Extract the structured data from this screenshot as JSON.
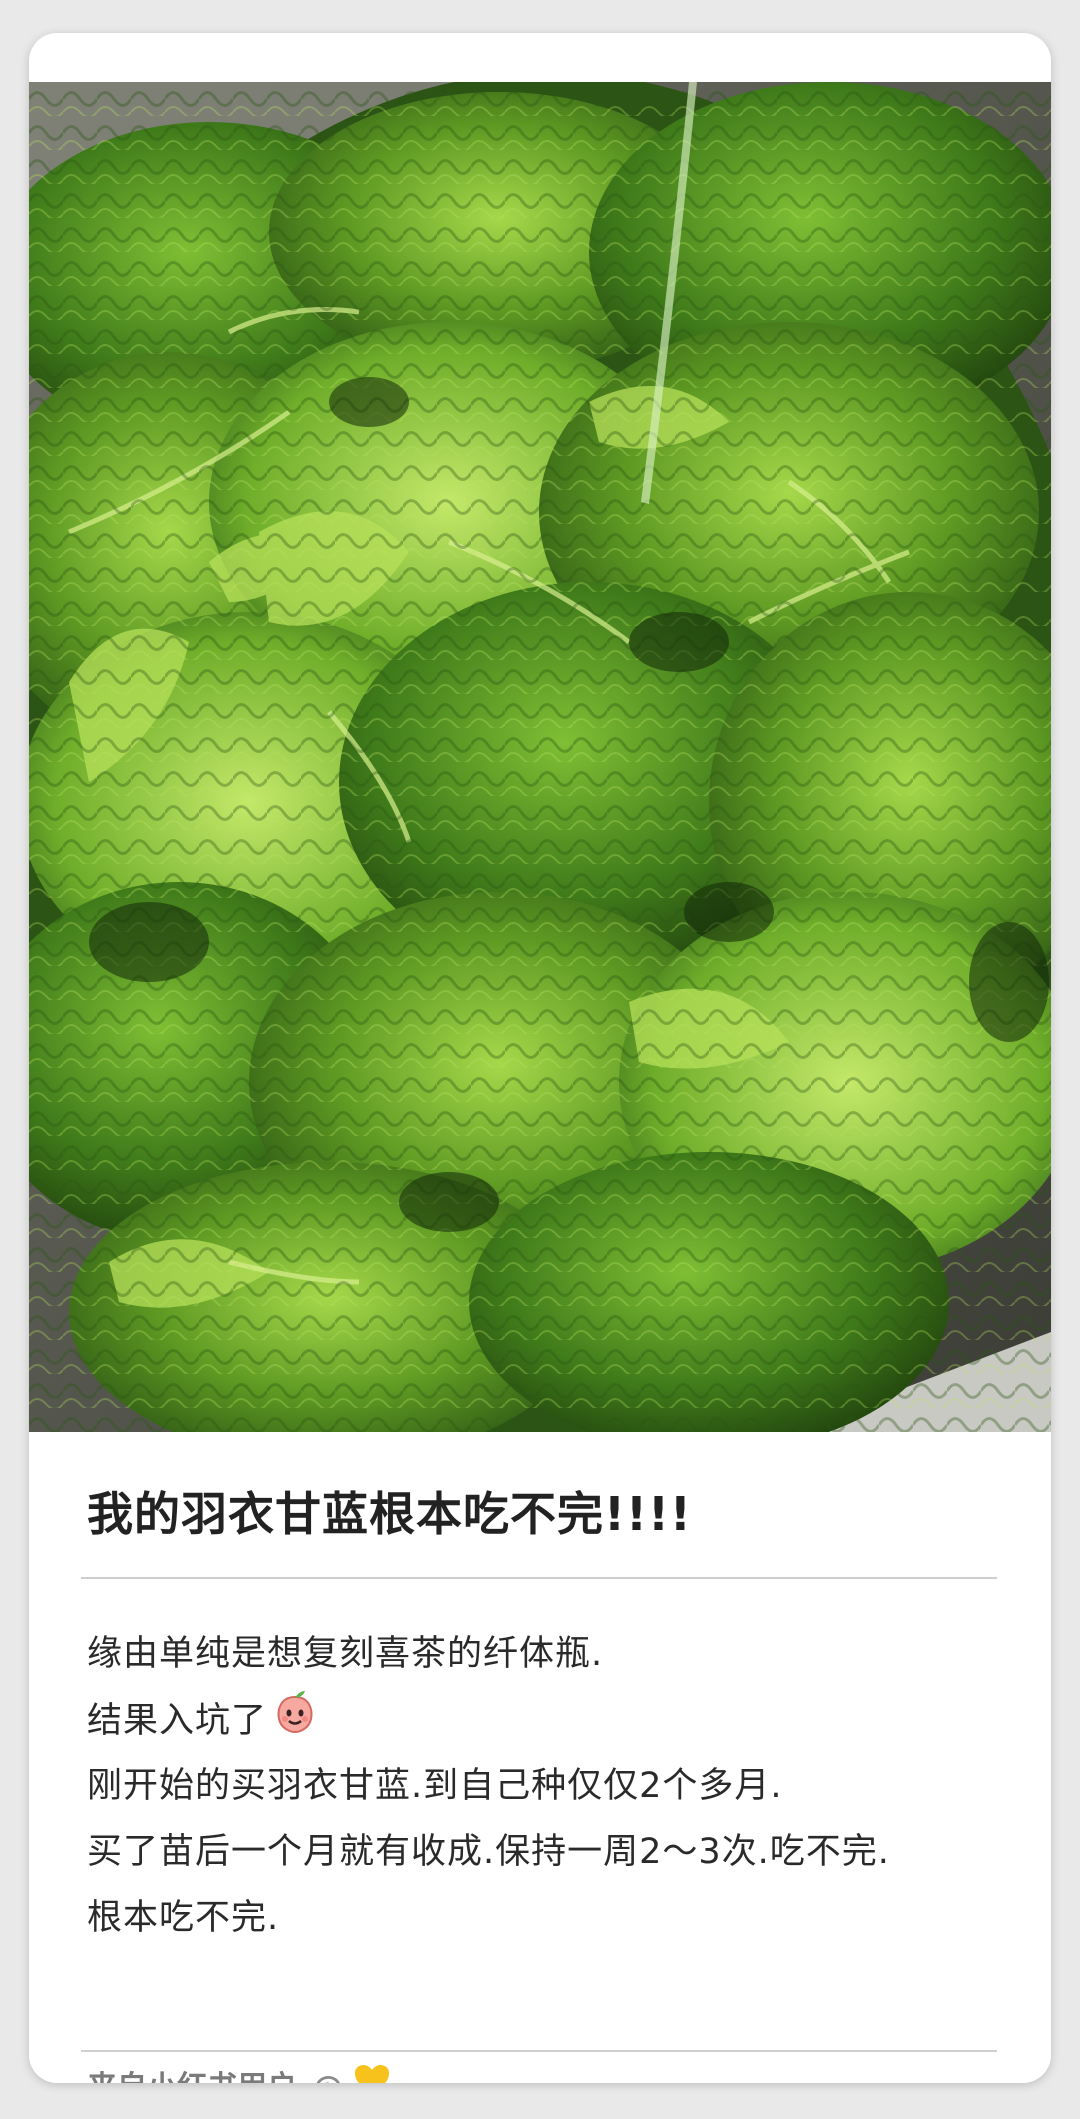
{
  "post": {
    "title": "我的羽衣甘蓝根本吃不完!!!!",
    "body_lines": [
      "缘由单纯是想复刻喜茶的纤体瓶.",
      "结果入坑了",
      "刚开始的买羽衣甘蓝.到自己种仅仅2个多月.",
      "买了苗后一个月就有收成.保持一周2～3次.吃不完.",
      "根本吃不完."
    ],
    "image_subject": "kale-leaves-in-sink-icon"
  },
  "footer": {
    "source": "来自小红书用户",
    "at": "@",
    "heart_icon": "yellow-heart-icon"
  },
  "colors": {
    "background": "#e9e9e9",
    "card": "#ffffff",
    "kale_dark": "#2f5a16",
    "kale_light": "#8cc63a",
    "heart": "#f6c21b"
  }
}
